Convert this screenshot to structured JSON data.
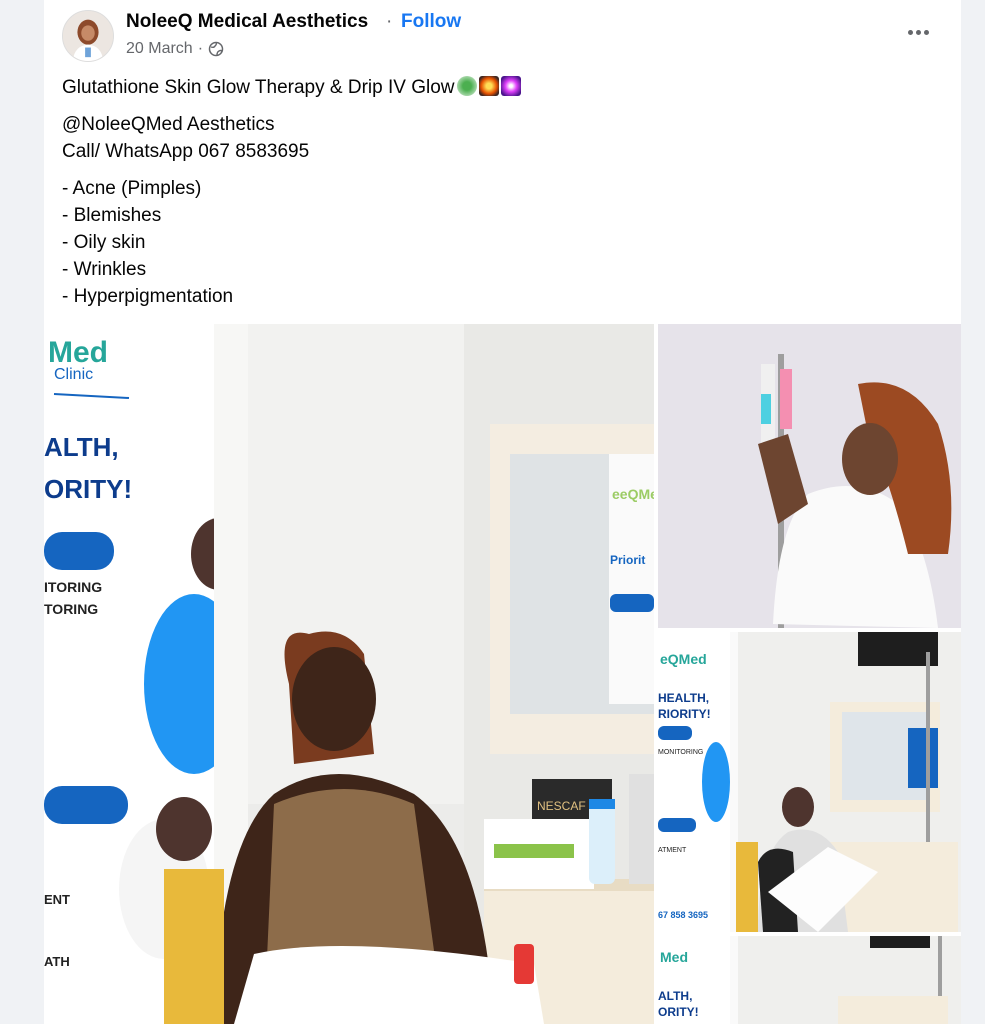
{
  "post": {
    "author": "NoleeQ Medical Aesthetics",
    "separator": "·",
    "follow_label": "Follow",
    "date": "20 March",
    "privacy_icon": "globe-icon",
    "more_icon": "more-options-icon",
    "lines": {
      "title": "Glutathione Skin Glow Therapy  & Drip IV Glow",
      "handle": "@NoleeQMed Aesthetics",
      "contact": "Call/ WhatsApp 067 8583695",
      "items": [
        "- Acne (Pimples)",
        "- Blemishes",
        "- Oily skin",
        "- Wrinkles",
        "- Hyperpigmentation"
      ]
    },
    "emojis": [
      "recycle-emoji",
      "fireworks-emoji",
      "sparkler-emoji"
    ]
  },
  "banner": {
    "brand": "Med",
    "clinic": "Clinic",
    "line1": "ALTH,",
    "line2": "ORITY!",
    "monitor1": "ITORING",
    "monitor2": "TORING",
    "side1": "ENT",
    "side2": "ATH",
    "mirror_brand": "eeQMe",
    "mirror_line": "Priorit",
    "box_label": "NESCAF"
  },
  "thumb_banner": {
    "brand": "eQMed",
    "line1": "HEALTH,",
    "line2": "RIORITY!",
    "monitor": "MONITORING",
    "treat": "ATMENT",
    "phone": "67 858 3695"
  },
  "bottom_banner": {
    "brand": "Med",
    "line1": "ALTH,",
    "line2": "ORITY!"
  },
  "colors": {
    "link": "#1877f2",
    "text": "#050505",
    "muted": "#65676b",
    "banner_blue": "#1565c0",
    "banner_green": "#26a69a"
  }
}
